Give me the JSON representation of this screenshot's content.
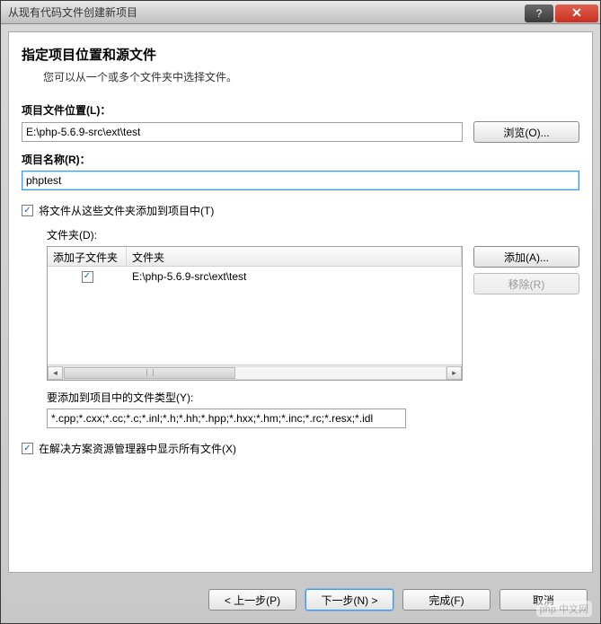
{
  "window": {
    "title": "从现有代码文件创建新项目"
  },
  "titlebar": {
    "help": "?",
    "close": "✕"
  },
  "header": {
    "heading": "指定项目位置和源文件",
    "subheading": "您可以从一个或多个文件夹中选择文件。"
  },
  "location": {
    "label": "项目文件位置(L)：",
    "value": "E:\\php-5.6.9-src\\ext\\test",
    "browse_label": "浏览(O)..."
  },
  "name": {
    "label": "项目名称(R)：",
    "value": "phptest"
  },
  "addFolders": {
    "checkbox_label": "将文件从这些文件夹添加到项目中(T)",
    "folders_label": "文件夹(D):",
    "columns": {
      "c1": "添加子文件夹",
      "c2": "文件夹"
    },
    "rows": [
      {
        "subfolders": true,
        "path": "E:\\php-5.6.9-src\\ext\\test"
      }
    ],
    "add_btn": "添加(A)...",
    "remove_btn": "移除(R)",
    "filetypes_label": "要添加到项目中的文件类型(Y):",
    "filetypes_value": "*.cpp;*.cxx;*.cc;*.c;*.inl;*.h;*.hh;*.hpp;*.hxx;*.hm;*.inc;*.rc;*.resx;*.idl"
  },
  "showAll": {
    "label": "在解决方案资源管理器中显示所有文件(X)"
  },
  "footer": {
    "prev": "< 上一步(P)",
    "next": "下一步(N) >",
    "finish": "完成(F)",
    "cancel": "取消"
  },
  "watermark": "php 中文网"
}
